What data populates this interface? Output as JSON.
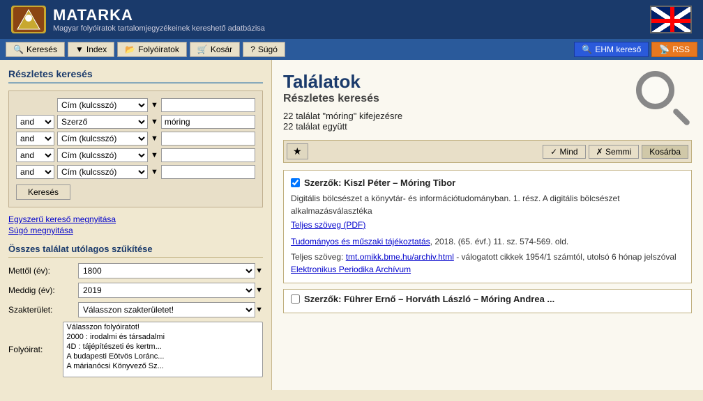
{
  "header": {
    "logo_text": "🏷",
    "title": "MATARKA",
    "subtitle": "Magyar folyóiratok tartalomjegyzékeinek kereshető adatbázisa",
    "flag_alt": "UK Flag"
  },
  "nav": {
    "buttons": [
      {
        "label": "Keresés",
        "icon": "🔍",
        "name": "search"
      },
      {
        "label": "Index",
        "icon": "▼",
        "name": "index"
      },
      {
        "label": "Folyóiratok",
        "icon": "📂",
        "name": "journals"
      },
      {
        "label": "Kosár",
        "icon": "🛒",
        "name": "cart"
      },
      {
        "label": "Súgó",
        "icon": "?",
        "name": "help"
      }
    ],
    "right_buttons": [
      {
        "label": "EHM kereső",
        "name": "ehm"
      },
      {
        "label": "RSS",
        "name": "rss"
      }
    ]
  },
  "sidebar": {
    "title": "Részletes keresés",
    "rows": [
      {
        "and_val": "",
        "field": "Cím (kulcsszó)",
        "value": ""
      },
      {
        "and_val": "and",
        "field": "Szerző",
        "value": "móring"
      },
      {
        "and_val": "and",
        "field": "Cím (kulcsszó)",
        "value": ""
      },
      {
        "and_val": "and",
        "field": "Cím (kulcsszó)",
        "value": ""
      },
      {
        "and_val": "and",
        "field": "Cím (kulcsszó)",
        "value": ""
      }
    ],
    "search_button": "Keresés",
    "links": [
      {
        "label": "Egyszerű kereső megnyitása",
        "href": "#"
      },
      {
        "label": "Súgó megnyitása",
        "href": "#"
      }
    ],
    "filter_title": "Összes találat utólagos szűkítése",
    "mettol_label": "Mettől (év):",
    "mettol_value": "1800",
    "meddig_label": "Meddig (év):",
    "meddig_value": "2019",
    "szakterulet_label": "Szakterület:",
    "szakterulet_placeholder": "Válasszon szakterületet!",
    "folyoirat_label": "Folyóirat:",
    "folyoirat_options": [
      "Válasszon folyóiratot!",
      "2000 : irodalmi és társadalmi",
      "4D : tájépítészeti és kertm...",
      "A budapesti Eötvös Loránc...",
      "A márianócsi Könyvező Sz..."
    ]
  },
  "results": {
    "title": "Találatok",
    "subtitle": "Részletes keresés",
    "count_line1": "22 találat \"móring\" kifejezésre",
    "count_line2": "22 találat együtt",
    "toolbar": {
      "star": "★",
      "mind": "✓ Mind",
      "semmi": "✗ Semmi",
      "kosarba": "Kosárba"
    },
    "items": [
      {
        "id": 1,
        "checked": true,
        "title": "Szerzők: Kiszl Péter – Móring Tibor",
        "description": "Digitális bölcsészet a könyvtár- és információtudományban. 1. rész. A digitális bölcsészet alkalmazásválasztéka",
        "fulltext_link": "Teljes szöveg (PDF)",
        "fulltext_href": "#",
        "extra_title": "Tudományos és műszaki tájékoztatás",
        "extra_href": "#",
        "extra_text": ", 2018. (65. évf.) 11. sz. 574-569. old.",
        "fulltext2": "Teljes szöveg: tmt.omikk.bme.hu/archiv.html - válogatott cikkek 1954/1 számtól, utolsó 6 hónap jelszóval",
        "fulltext2_link": "tmt.omikk.bme.hu/archiv.html",
        "fulltext2_href": "#",
        "archive_link": "Elektronikus Periodika Archívum",
        "archive_href": "#"
      },
      {
        "id": 2,
        "checked": false,
        "title": "Szerzők: Führer Ernő – Horváth László – Móring Andrea ...",
        "description": "",
        "fulltext_link": "",
        "fulltext_href": "#",
        "extra_title": "",
        "extra_href": "#",
        "extra_text": "",
        "fulltext2": "",
        "archive_link": "",
        "archive_href": "#"
      }
    ]
  }
}
